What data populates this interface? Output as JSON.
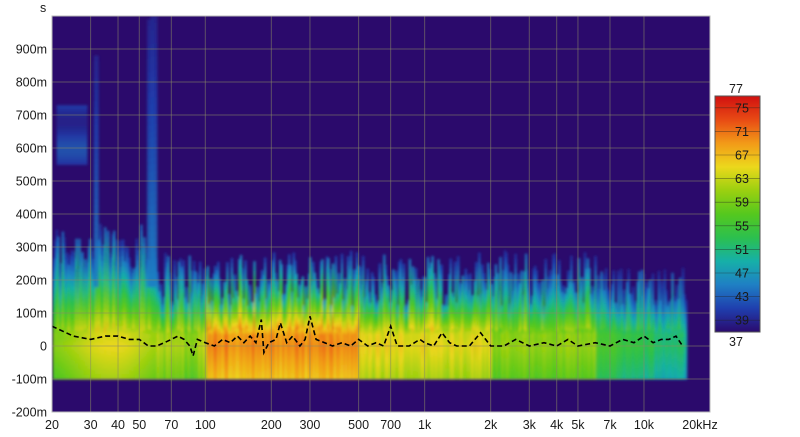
{
  "chart_data": {
    "type": "heatmap",
    "title": "",
    "xlabel": "",
    "ylabel": "",
    "y_unit": "s",
    "x_scale": "log",
    "xlim": [
      20,
      20000
    ],
    "ylim": [
      -0.2,
      1.0
    ],
    "x_ticks": [
      {
        "value": 20,
        "label": "20"
      },
      {
        "value": 30,
        "label": "30"
      },
      {
        "value": 40,
        "label": "40"
      },
      {
        "value": 50,
        "label": "50"
      },
      {
        "value": 70,
        "label": "70"
      },
      {
        "value": 100,
        "label": "100"
      },
      {
        "value": 200,
        "label": "200"
      },
      {
        "value": 300,
        "label": "300"
      },
      {
        "value": 500,
        "label": "500"
      },
      {
        "value": 700,
        "label": "700"
      },
      {
        "value": 1000,
        "label": "1k"
      },
      {
        "value": 2000,
        "label": "2k"
      },
      {
        "value": 3000,
        "label": "3k"
      },
      {
        "value": 4000,
        "label": "4k"
      },
      {
        "value": 5000,
        "label": "5k"
      },
      {
        "value": 7000,
        "label": "7k"
      },
      {
        "value": 10000,
        "label": "10k"
      },
      {
        "value": 20000,
        "label": "20kHz"
      }
    ],
    "y_ticks": [
      {
        "value": 0.9,
        "label": "900m"
      },
      {
        "value": 0.8,
        "label": "800m"
      },
      {
        "value": 0.7,
        "label": "700m"
      },
      {
        "value": 0.6,
        "label": "600m"
      },
      {
        "value": 0.5,
        "label": "500m"
      },
      {
        "value": 0.4,
        "label": "400m"
      },
      {
        "value": 0.3,
        "label": "300m"
      },
      {
        "value": 0.2,
        "label": "200m"
      },
      {
        "value": 0.1,
        "label": "100m"
      },
      {
        "value": 0.0,
        "label": "0"
      },
      {
        "value": -0.1,
        "label": "-100m"
      },
      {
        "value": -0.2,
        "label": "-200m"
      }
    ],
    "colorbar": {
      "min": 37,
      "max": 77,
      "min_label": "37",
      "max_label": "77",
      "ticks": [
        {
          "value": 75,
          "label": "75"
        },
        {
          "value": 71,
          "label": "71"
        },
        {
          "value": 67,
          "label": "67"
        },
        {
          "value": 63,
          "label": "63"
        },
        {
          "value": 59,
          "label": "59"
        },
        {
          "value": 55,
          "label": "55"
        },
        {
          "value": 51,
          "label": "51"
        },
        {
          "value": 47,
          "label": "47"
        },
        {
          "value": 43,
          "label": "43"
        },
        {
          "value": 39,
          "label": "39"
        }
      ],
      "colors": [
        "#2a0a6e",
        "#1f3fae",
        "#1f7fc4",
        "#16b0a8",
        "#2cc04e",
        "#55c81e",
        "#9bd010",
        "#ecd81c",
        "#f29a18",
        "#e84a14",
        "#d01010"
      ]
    },
    "background_color": "#2b0a6c",
    "grid": true,
    "ridge_line": {
      "style": "dashed",
      "color": "#000000",
      "points": [
        [
          20,
          0.06
        ],
        [
          25,
          0.03
        ],
        [
          30,
          0.02
        ],
        [
          35,
          0.03
        ],
        [
          40,
          0.03
        ],
        [
          45,
          0.02
        ],
        [
          50,
          0.02
        ],
        [
          55,
          0.0
        ],
        [
          60,
          0.0
        ],
        [
          65,
          0.01
        ],
        [
          70,
          0.02
        ],
        [
          75,
          0.03
        ],
        [
          80,
          0.02
        ],
        [
          85,
          0.0
        ],
        [
          88,
          -0.03
        ],
        [
          92,
          0.02
        ],
        [
          100,
          0.01
        ],
        [
          110,
          0.0
        ],
        [
          120,
          0.02
        ],
        [
          130,
          0.01
        ],
        [
          140,
          0.03
        ],
        [
          150,
          0.01
        ],
        [
          160,
          0.03
        ],
        [
          170,
          0.01
        ],
        [
          180,
          0.08
        ],
        [
          185,
          -0.02
        ],
        [
          195,
          0.01
        ],
        [
          210,
          0.02
        ],
        [
          220,
          0.07
        ],
        [
          235,
          0.01
        ],
        [
          250,
          0.03
        ],
        [
          270,
          0.0
        ],
        [
          285,
          0.02
        ],
        [
          300,
          0.09
        ],
        [
          320,
          0.02
        ],
        [
          350,
          0.01
        ],
        [
          380,
          0.0
        ],
        [
          420,
          0.01
        ],
        [
          460,
          0.0
        ],
        [
          500,
          0.02
        ],
        [
          550,
          0.0
        ],
        [
          600,
          0.01
        ],
        [
          650,
          0.0
        ],
        [
          700,
          0.06
        ],
        [
          750,
          0.0
        ],
        [
          850,
          0.0
        ],
        [
          950,
          0.02
        ],
        [
          1000,
          0.01
        ],
        [
          1100,
          0.0
        ],
        [
          1200,
          0.04
        ],
        [
          1300,
          0.01
        ],
        [
          1400,
          0.0
        ],
        [
          1600,
          0.0
        ],
        [
          1800,
          0.04
        ],
        [
          2000,
          0.0
        ],
        [
          2300,
          0.0
        ],
        [
          2600,
          0.02
        ],
        [
          3000,
          0.0
        ],
        [
          3500,
          0.01
        ],
        [
          4000,
          0.0
        ],
        [
          4500,
          0.02
        ],
        [
          5000,
          0.0
        ],
        [
          6000,
          0.01
        ],
        [
          7000,
          0.0
        ],
        [
          8000,
          0.02
        ],
        [
          9000,
          0.01
        ],
        [
          10000,
          0.03
        ],
        [
          11000,
          0.01
        ],
        [
          12000,
          0.02
        ],
        [
          13000,
          0.02
        ],
        [
          14000,
          0.03
        ],
        [
          15000,
          0.0
        ]
      ]
    }
  }
}
